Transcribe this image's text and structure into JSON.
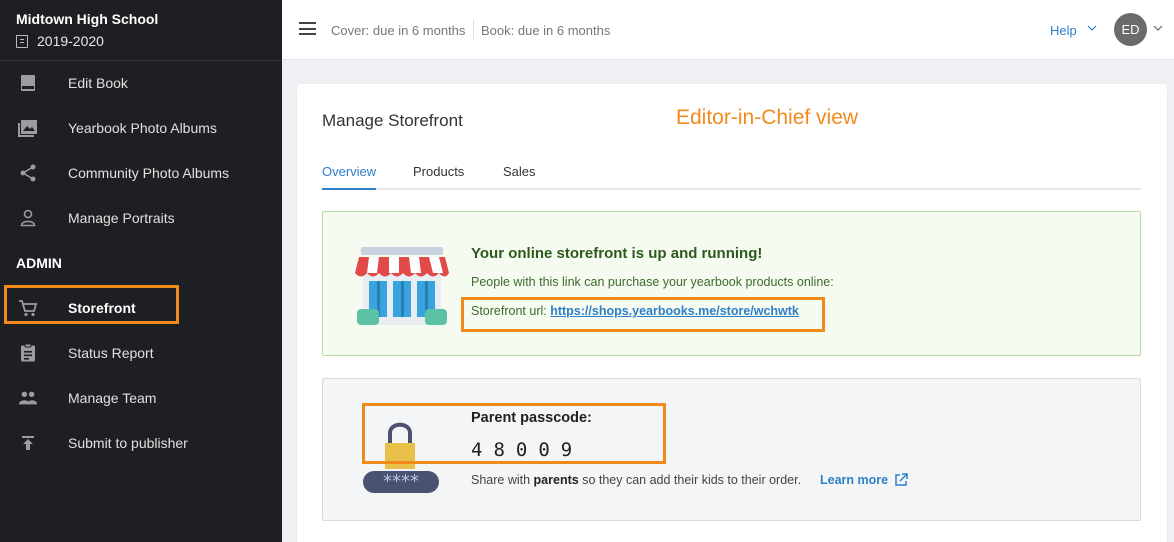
{
  "sidebar": {
    "school_name": "Midtown High School",
    "year": "2019-2020",
    "admin_label": "ADMIN",
    "items": [
      {
        "label": "Edit Book",
        "icon": "book-icon"
      },
      {
        "label": "Yearbook Photo Albums",
        "icon": "photo-album-icon"
      },
      {
        "label": "Community Photo Albums",
        "icon": "share-icon"
      },
      {
        "label": "Manage Portraits",
        "icon": "person-icon"
      },
      {
        "label": "Storefront",
        "icon": "cart-icon",
        "active": true
      },
      {
        "label": "Status Report",
        "icon": "clipboard-icon"
      },
      {
        "label": "Manage Team",
        "icon": "team-icon"
      },
      {
        "label": "Submit to publisher",
        "icon": "upload-icon"
      }
    ]
  },
  "topbar": {
    "cover_due": "Cover: due in 6 months",
    "book_due": "Book: due in 6 months",
    "help_label": "Help",
    "avatar_initials": "ED"
  },
  "main": {
    "title": "Manage Storefront",
    "view_note": "Editor-in-Chief view",
    "tabs": [
      {
        "label": "Overview",
        "active": true
      },
      {
        "label": "Products"
      },
      {
        "label": "Sales"
      }
    ],
    "storefront": {
      "heading": "Your online storefront is up and running!",
      "description": "People with this link can purchase your yearbook products online:",
      "url_label": "Storefront url:",
      "url": "https://shops.yearbooks.me/store/wchwtk"
    },
    "passcode": {
      "heading": "Parent passcode:",
      "code": "48009",
      "share_prefix": "Share with",
      "share_bold": "parents",
      "share_suffix": "so they can add their kids to their order.",
      "learn_more": "Learn more",
      "masked": "****"
    }
  },
  "colors": {
    "accent": "#2f7fc9",
    "highlight": "#f28a1b",
    "sidebar_bg": "#1e1f22",
    "success_bg": "#f6fbf2"
  }
}
